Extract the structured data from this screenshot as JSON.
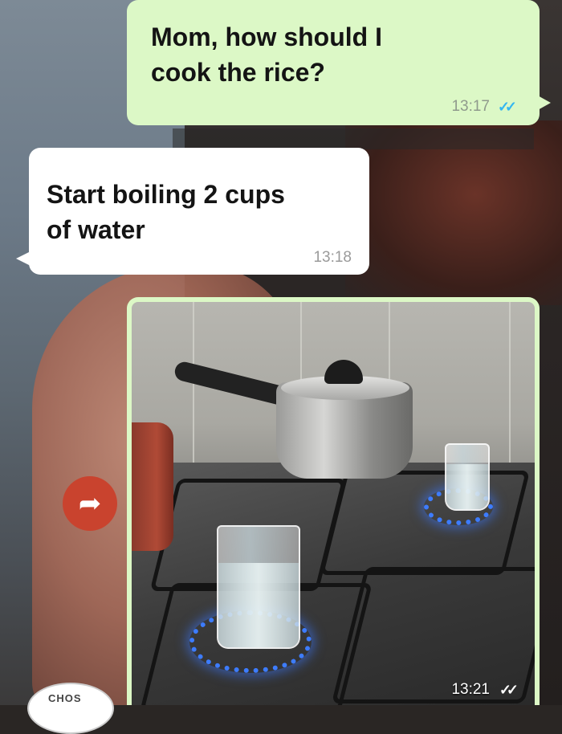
{
  "messages": [
    {
      "direction": "outgoing",
      "text": "Mom, how should I\ncook the rice?",
      "time": "13:17",
      "status": "read"
    },
    {
      "direction": "incoming",
      "text": "Start boiling 2 cups\nof water",
      "time": "13:18"
    },
    {
      "direction": "outgoing",
      "type": "image",
      "time": "13:21",
      "status": "read"
    }
  ],
  "colors": {
    "outgoing_bubble": "#dcf8c6",
    "incoming_bubble": "#ffffff",
    "read_ticks": "#34b7f1",
    "forward_button": "#c9432e"
  },
  "icons": {
    "read_receipt": "double-check-icon",
    "forward": "share-arrow-icon"
  },
  "forward_glyph": "➦",
  "ticks_glyph": "✓✓",
  "corner_logo_text": "CHOS"
}
